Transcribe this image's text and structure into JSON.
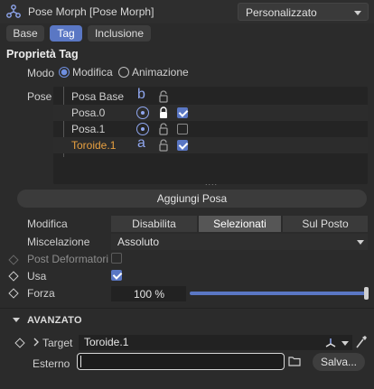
{
  "header": {
    "title": "Pose Morph [Pose Morph]",
    "preset_dropdown": "Personalizzato",
    "icon": "pose-morph-icon"
  },
  "tabs": [
    {
      "label": "Base",
      "active": false
    },
    {
      "label": "Tag",
      "active": true
    },
    {
      "label": "Inclusione",
      "active": false
    }
  ],
  "section_title": "Proprietà Tag",
  "mode": {
    "label": "Modo",
    "options": [
      {
        "label": "Modifica",
        "selected": true
      },
      {
        "label": "Animazione",
        "selected": false
      }
    ]
  },
  "poses": {
    "label": "Pose",
    "items": [
      {
        "name": "Posa Base",
        "symbol": "b",
        "locked": false,
        "enabled": null,
        "selected": false
      },
      {
        "name": "Posa.0",
        "symbol": "target-icon",
        "locked": true,
        "enabled": true,
        "selected": false
      },
      {
        "name": "Posa.1",
        "symbol": "target-icon",
        "locked": false,
        "enabled": false,
        "selected": false
      },
      {
        "name": "Toroide.1",
        "symbol": "a",
        "locked": false,
        "enabled": true,
        "selected": true
      }
    ],
    "resize_handle": "....",
    "add_button": "Aggiungi Posa"
  },
  "edit": {
    "label": "Modifica",
    "options": [
      {
        "label": "Disabilita",
        "selected": false
      },
      {
        "label": "Selezionati",
        "selected": true
      },
      {
        "label": "Sul Posto",
        "selected": false
      }
    ]
  },
  "blend": {
    "label": "Miscelazione",
    "value": "Assoluto"
  },
  "post_deformers": {
    "label": "Post Deformatori",
    "checked": false
  },
  "use": {
    "label": "Usa",
    "checked": true
  },
  "strength": {
    "label": "Forza",
    "value": "100 %",
    "level": 1.0
  },
  "advanced": {
    "title": "AVANZATO",
    "target": {
      "label": "Target",
      "value": "Toroide.1"
    },
    "external": {
      "label": "Esterno",
      "value": ""
    },
    "save_button": "Salva..."
  },
  "colors": {
    "accent": "#5a77c4",
    "selected_pose": "#e8a040",
    "background": "#2b2b2b"
  }
}
